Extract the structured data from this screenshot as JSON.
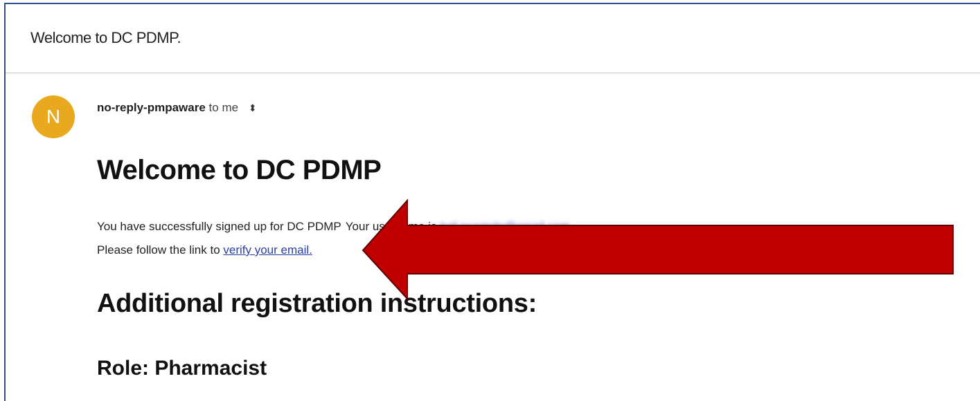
{
  "email": {
    "subject": "Welcome to DC PDMP.",
    "avatar_initial": "N",
    "sender": "no-reply-pmpaware",
    "recipient": "to me",
    "details_toggle_icon": "⬍",
    "title": "Welcome to DC PDMP",
    "body_line1_visible": "You have successfully signed up for DC PDMP",
    "body_line1_hidden": "Your username is",
    "body_line1_email": "kaf.example@email.com",
    "body_line2_prefix": "Please follow the link to ",
    "verify_link": "verify your email.",
    "section_heading": "Additional registration instructions:",
    "role": "Role: Pharmacist"
  },
  "annotation": {
    "arrow_color": "#c00000",
    "arrow_outline": "#5a0000"
  }
}
